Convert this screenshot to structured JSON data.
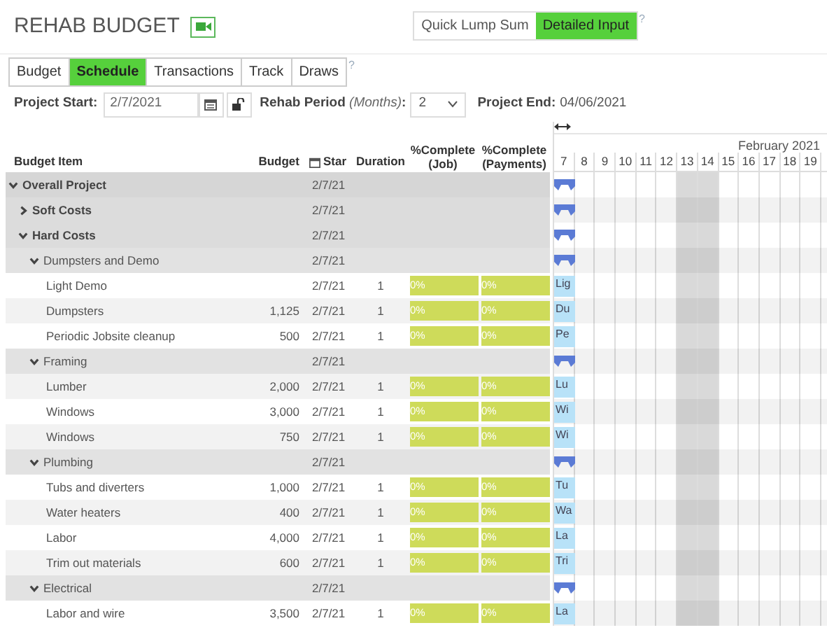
{
  "title": "REHAB BUDGET",
  "mode_toggle": [
    {
      "label": "Quick Lump Sum",
      "selected": false
    },
    {
      "label": "Detailed Input",
      "selected": true
    }
  ],
  "mode_help": "?",
  "tabs": [
    {
      "label": "Budget",
      "selected": false
    },
    {
      "label": "Schedule",
      "selected": true
    },
    {
      "label": "Transactions",
      "selected": false
    },
    {
      "label": "Track",
      "selected": false
    },
    {
      "label": "Draws",
      "selected": false
    }
  ],
  "tabs_help": "?",
  "project_start": {
    "label": "Project Start:",
    "value": "2/7/2021",
    "locked": false
  },
  "rehab_period": {
    "label": "Rehab Period",
    "unit": "(Months)",
    "colon": ":",
    "value": "2"
  },
  "project_end": {
    "label": "Project End:",
    "value": "04/06/2021"
  },
  "columns": [
    {
      "line1": "Budget Item"
    },
    {
      "line1": "Budget"
    },
    {
      "line1": "Star"
    },
    {
      "line1": "Duration"
    },
    {
      "line1": "%Complete",
      "line2": "(Job)"
    },
    {
      "line1": "%Complete",
      "line2": "(Payments)"
    }
  ],
  "gantt": {
    "month": "February 2021",
    "days": [
      {
        "label": "7",
        "weekend": false
      },
      {
        "label": "8",
        "weekend": false
      },
      {
        "label": "9",
        "weekend": false
      },
      {
        "label": "10",
        "weekend": false
      },
      {
        "label": "11",
        "weekend": false
      },
      {
        "label": "12",
        "weekend": false
      },
      {
        "label": "13",
        "weekend": true
      },
      {
        "label": "14",
        "weekend": true
      },
      {
        "label": "15",
        "weekend": false
      },
      {
        "label": "16",
        "weekend": false
      },
      {
        "label": "17",
        "weekend": false
      },
      {
        "label": "18",
        "weekend": false
      },
      {
        "label": "19",
        "weekend": false
      }
    ]
  },
  "rows": [
    {
      "kind": "group",
      "name": "Overall Project",
      "start": "2/7/21",
      "expanded": true,
      "children": [
        {
          "kind": "group",
          "name": "Soft Costs",
          "start": "2/7/21",
          "expanded": false
        },
        {
          "kind": "group",
          "name": "Hard Costs",
          "start": "2/7/21",
          "expanded": true,
          "children": [
            {
              "kind": "group",
              "name": "Dumpsters and Demo",
              "start": "2/7/21",
              "expanded": true,
              "children": [
                {
                  "kind": "item",
                  "name": "Light Demo",
                  "start": "2/7/21",
                  "duration": "1",
                  "job": "0%",
                  "payments": "0%",
                  "bar_label": "Lig"
                },
                {
                  "kind": "item",
                  "name": "Dumpsters",
                  "budget": "1,125",
                  "start": "2/7/21",
                  "duration": "1",
                  "job": "0%",
                  "payments": "0%",
                  "bar_label": "Du"
                },
                {
                  "kind": "item",
                  "name": "Periodic Jobsite cleanup",
                  "budget": "500",
                  "start": "2/7/21",
                  "duration": "1",
                  "job": "0%",
                  "payments": "0%",
                  "bar_label": "Pe"
                }
              ]
            },
            {
              "kind": "group",
              "name": "Framing",
              "start": "2/7/21",
              "expanded": true,
              "children": [
                {
                  "kind": "item",
                  "name": "Lumber",
                  "budget": "2,000",
                  "start": "2/7/21",
                  "duration": "1",
                  "job": "0%",
                  "payments": "0%",
                  "bar_label": "Lu"
                },
                {
                  "kind": "item",
                  "name": "Windows",
                  "budget": "3,000",
                  "start": "2/7/21",
                  "duration": "1",
                  "job": "0%",
                  "payments": "0%",
                  "bar_label": "Wi"
                },
                {
                  "kind": "item",
                  "name": "Windows",
                  "budget": "750",
                  "start": "2/7/21",
                  "duration": "1",
                  "job": "0%",
                  "payments": "0%",
                  "bar_label": "Wi"
                }
              ]
            },
            {
              "kind": "group",
              "name": "Plumbing",
              "start": "2/7/21",
              "expanded": true,
              "children": [
                {
                  "kind": "item",
                  "name": "Tubs and diverters",
                  "budget": "1,000",
                  "start": "2/7/21",
                  "duration": "1",
                  "job": "0%",
                  "payments": "0%",
                  "bar_label": "Tu"
                },
                {
                  "kind": "item",
                  "name": "Water heaters",
                  "budget": "400",
                  "start": "2/7/21",
                  "duration": "1",
                  "job": "0%",
                  "payments": "0%",
                  "bar_label": "Wa"
                },
                {
                  "kind": "item",
                  "name": "Labor",
                  "budget": "4,000",
                  "start": "2/7/21",
                  "duration": "1",
                  "job": "0%",
                  "payments": "0%",
                  "bar_label": "La"
                },
                {
                  "kind": "item",
                  "name": "Trim out materials",
                  "budget": "600",
                  "start": "2/7/21",
                  "duration": "1",
                  "job": "0%",
                  "payments": "0%",
                  "bar_label": "Tri"
                }
              ]
            },
            {
              "kind": "group",
              "name": "Electrical",
              "start": "2/7/21",
              "expanded": true,
              "children": [
                {
                  "kind": "item",
                  "name": "Labor and wire",
                  "budget": "3,500",
                  "start": "2/7/21",
                  "duration": "1",
                  "job": "0%",
                  "payments": "0%",
                  "bar_label": "La"
                }
              ]
            }
          ]
        }
      ]
    }
  ]
}
